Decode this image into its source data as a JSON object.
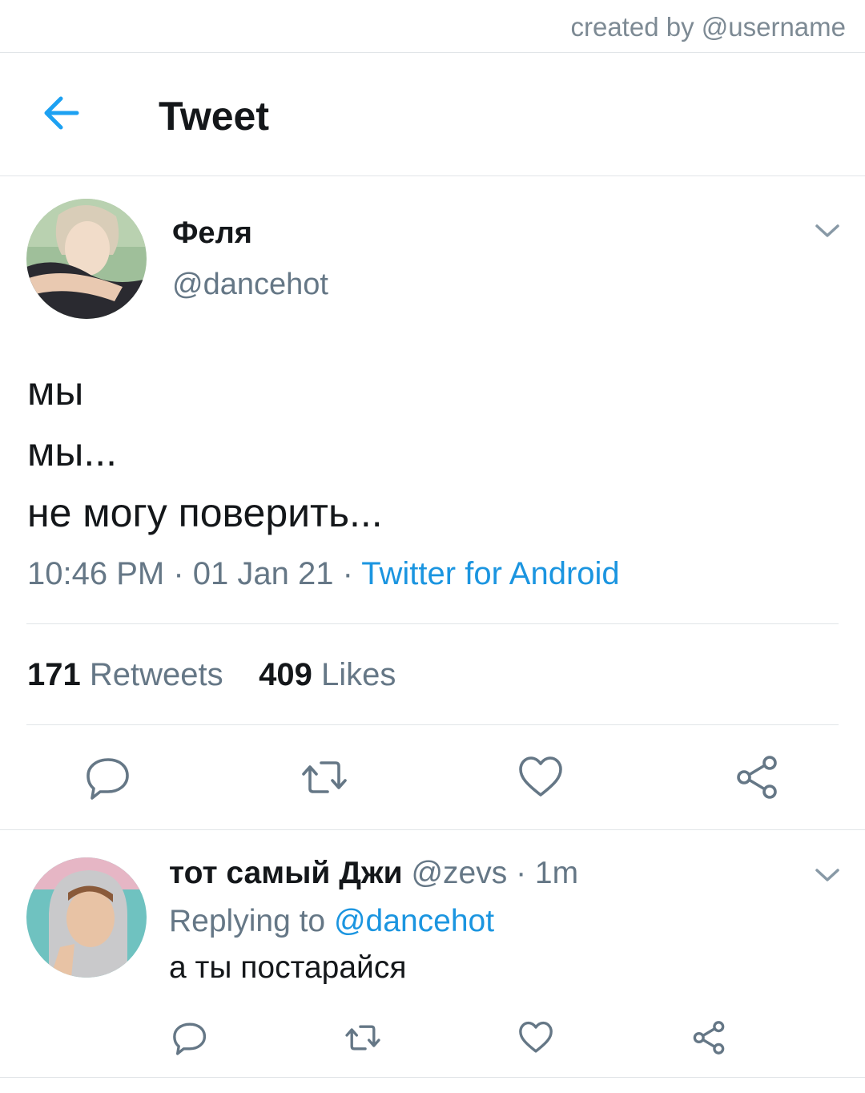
{
  "credit": "created by @username",
  "header": {
    "title": "Tweet"
  },
  "tweet": {
    "author_name": "Феля",
    "author_handle": "@dancehot",
    "lines": [
      "мы",
      "мы...",
      "не могу поверить..."
    ],
    "time": "10:46 PM",
    "date": "01 Jan 21",
    "source": "Twitter for Android",
    "retweets_count": "171",
    "retweets_label": "Retweets",
    "likes_count": "409",
    "likes_label": "Likes"
  },
  "reply": {
    "author_name": "тот самый Джи",
    "author_handle": "@zevs",
    "time": "1m",
    "replying_prefix": "Replying to",
    "replying_to": "@dancehot",
    "text": "а ты постарайся"
  },
  "colors": {
    "accent": "#1da1f2",
    "link": "#1b95e0",
    "secondary_text": "#657786",
    "icon_gray": "#657786",
    "divider": "#e1e5e8"
  },
  "icons": [
    "back-arrow-icon",
    "chevron-down-icon",
    "comment-icon",
    "retweet-icon",
    "heart-icon",
    "share-icon"
  ]
}
